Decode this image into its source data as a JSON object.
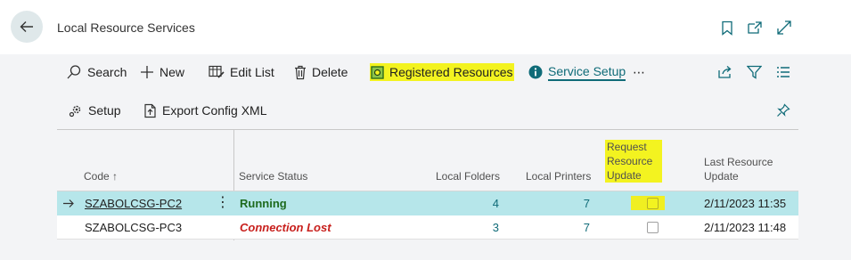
{
  "header": {
    "title": "Local Resource Services",
    "icons": [
      "back-arrow-icon",
      "bookmark-icon",
      "open-new-window-icon",
      "expand-icon"
    ]
  },
  "actions": {
    "search": "Search",
    "new": "New",
    "edit_list": "Edit List",
    "delete": "Delete",
    "registered_resources": "Registered Resources",
    "service_setup": "Service Setup",
    "more": "⋯",
    "setup": "Setup",
    "export_config": "Export Config XML"
  },
  "columns": {
    "code": "Code ↑",
    "service_status": "Service Status",
    "local_folders": "Local Folders",
    "local_printers": "Local Printers",
    "request_update_1": "Request",
    "request_update_2": "Resource",
    "request_update_3": "Update",
    "last_update_1": "Last Resource",
    "last_update_2": "Update"
  },
  "rows": [
    {
      "code": "SZABOLCSG-PC2",
      "status": "Running",
      "local_folders": "4",
      "local_printers": "7",
      "request_update": false,
      "last_update": "2/11/2023 11:35",
      "selected": true
    },
    {
      "code": "SZABOLCSG-PC3",
      "status": "Connection Lost",
      "local_folders": "3",
      "local_printers": "7",
      "request_update": false,
      "last_update": "2/11/2023 11:48",
      "selected": false
    }
  ],
  "colors": {
    "accent": "#0f6b78",
    "highlight": "#f3f320",
    "selected_row": "#b6e6ea",
    "running": "#1e6b1e",
    "lost": "#c8201d"
  }
}
